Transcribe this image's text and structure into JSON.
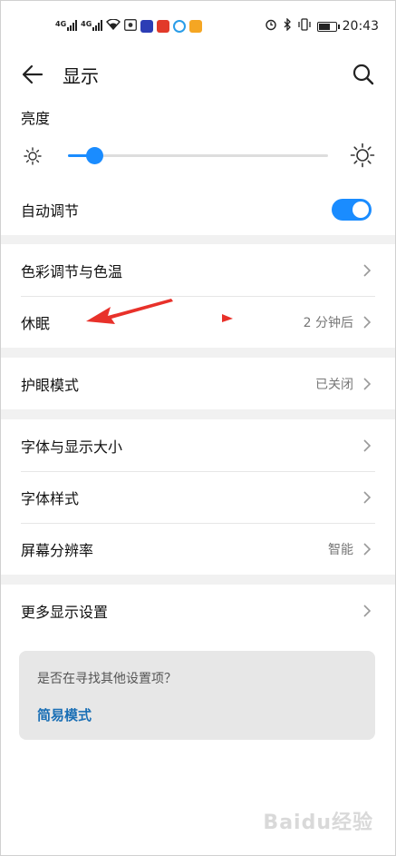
{
  "status_bar": {
    "network_left": "4G",
    "network_right": "4G",
    "time": "20:43"
  },
  "header": {
    "title": "显示",
    "back_icon": "back-arrow-icon",
    "search_icon": "search-icon"
  },
  "brightness": {
    "label": "亮度",
    "level": 0.1,
    "auto_adjust_label": "自动调节",
    "auto_adjust_on": true
  },
  "group1": {
    "items": [
      {
        "label": "色彩调节与色温",
        "value": ""
      },
      {
        "label": "休眠",
        "value": "2 分钟后"
      }
    ]
  },
  "group2": {
    "items": [
      {
        "label": "护眼模式",
        "value": "已关闭"
      }
    ]
  },
  "group3": {
    "items": [
      {
        "label": "字体与显示大小",
        "value": ""
      },
      {
        "label": "字体样式",
        "value": ""
      },
      {
        "label": "屏幕分辨率",
        "value": "智能"
      }
    ]
  },
  "group4": {
    "items": [
      {
        "label": "更多显示设置",
        "value": ""
      }
    ]
  },
  "hint": {
    "question": "是否在寻找其他设置项？",
    "link": "简易模式"
  },
  "colors": {
    "accent": "#1a8cff",
    "annotation_arrow": "#e8312a",
    "link": "#1a6fb5"
  },
  "watermark": "Baidu经验"
}
